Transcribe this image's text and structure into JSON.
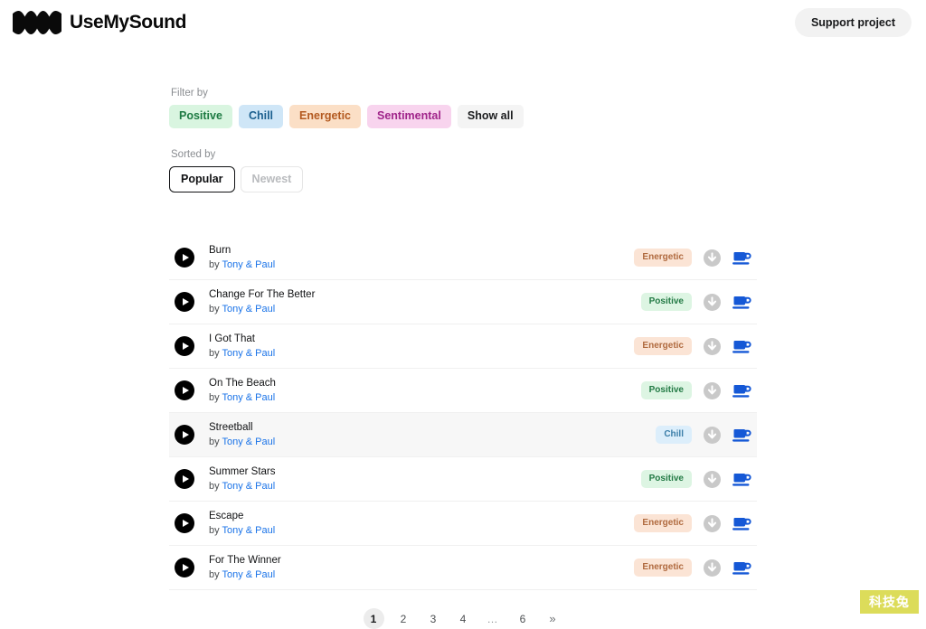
{
  "header": {
    "brand_name": "UseMySound",
    "logo_icon": "wave-logo-icon",
    "support_button": "Support project"
  },
  "filter": {
    "label": "Filter by",
    "chips": [
      {
        "label": "Positive",
        "style": "positive",
        "bg": "#d9f5e0",
        "fg": "#1d7a42"
      },
      {
        "label": "Chill",
        "style": "chill",
        "bg": "#cfe6f7",
        "fg": "#1b5f8e"
      },
      {
        "label": "Energetic",
        "style": "energetic",
        "bg": "#fbdfc6",
        "fg": "#b3591f"
      },
      {
        "label": "Sentimental",
        "style": "sentimental",
        "bg": "#f8d4ee",
        "fg": "#a0248a"
      },
      {
        "label": "Show all",
        "style": "showall",
        "bg": "#f4f4f4",
        "fg": "#1b1c1e"
      }
    ]
  },
  "sort": {
    "label": "Sorted by",
    "options": [
      {
        "label": "Popular",
        "active": true
      },
      {
        "label": "Newest",
        "active": false
      }
    ]
  },
  "tracks": [
    {
      "title": "Burn",
      "by_prefix": "by ",
      "artist": "Tony & Paul",
      "tag": "Energetic",
      "tag_style": "energetic",
      "hovered": false
    },
    {
      "title": "Change For The Better",
      "by_prefix": "by ",
      "artist": "Tony & Paul",
      "tag": "Positive",
      "tag_style": "positive",
      "hovered": false
    },
    {
      "title": "I Got That",
      "by_prefix": "by ",
      "artist": "Tony & Paul",
      "tag": "Energetic",
      "tag_style": "energetic",
      "hovered": false
    },
    {
      "title": "On The Beach",
      "by_prefix": "by ",
      "artist": "Tony & Paul",
      "tag": "Positive",
      "tag_style": "positive",
      "hovered": false
    },
    {
      "title": "Streetball",
      "by_prefix": "by ",
      "artist": "Tony & Paul",
      "tag": "Chill",
      "tag_style": "chill",
      "hovered": true
    },
    {
      "title": "Summer Stars",
      "by_prefix": "by ",
      "artist": "Tony & Paul",
      "tag": "Positive",
      "tag_style": "positive",
      "hovered": false
    },
    {
      "title": "Escape",
      "by_prefix": "by ",
      "artist": "Tony & Paul",
      "tag": "Energetic",
      "tag_style": "energetic",
      "hovered": false
    },
    {
      "title": "For The Winner",
      "by_prefix": "by ",
      "artist": "Tony & Paul",
      "tag": "Energetic",
      "tag_style": "energetic",
      "hovered": false
    }
  ],
  "row_icons": {
    "play": "play-icon",
    "download": "download-icon",
    "coffee": "coffee-cup-icon"
  },
  "pagination": {
    "items": [
      {
        "label": "1",
        "active": true,
        "kind": "page"
      },
      {
        "label": "2",
        "active": false,
        "kind": "page"
      },
      {
        "label": "3",
        "active": false,
        "kind": "page"
      },
      {
        "label": "4",
        "active": false,
        "kind": "page"
      },
      {
        "label": "…",
        "active": false,
        "kind": "ellipsis"
      },
      {
        "label": "6",
        "active": false,
        "kind": "page"
      },
      {
        "label": "»",
        "active": false,
        "kind": "next"
      }
    ]
  },
  "watermark": {
    "text": "科技兔",
    "bg": "#dcdc5a"
  }
}
